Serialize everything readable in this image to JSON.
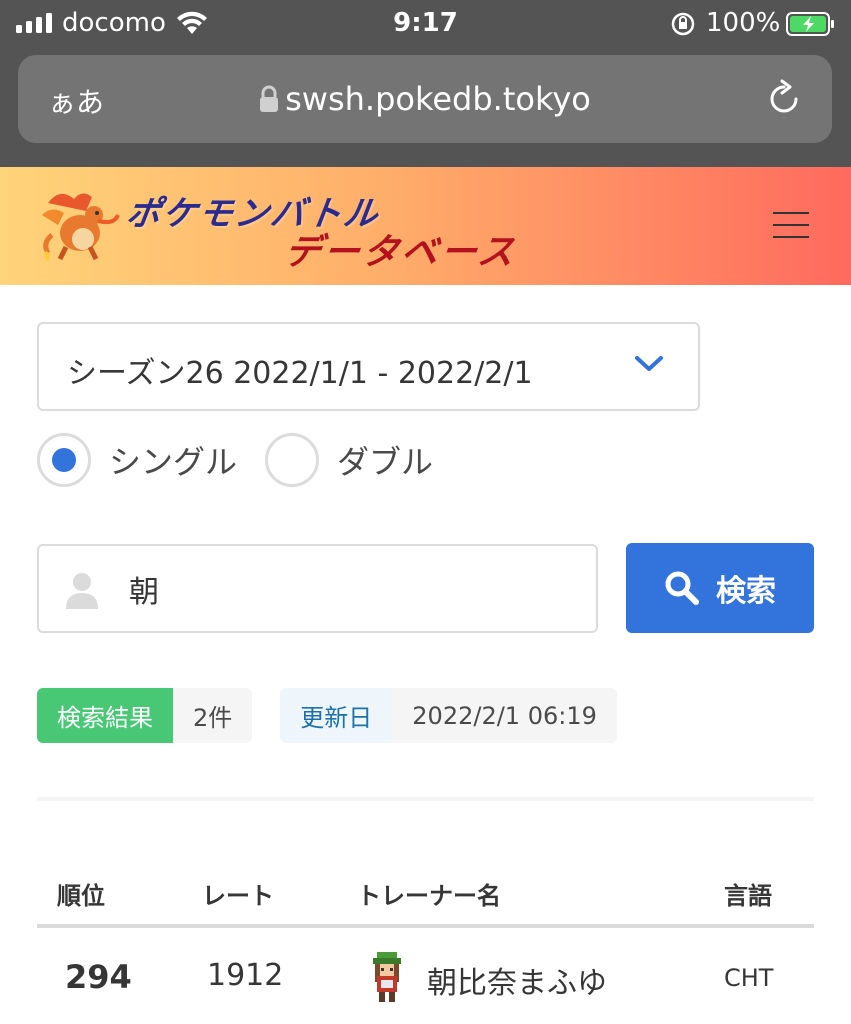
{
  "status_bar": {
    "carrier": "docomo",
    "time": "9:17",
    "battery_pct": "100%"
  },
  "browser": {
    "text_size_button": "ぁあ",
    "url": "swsh.pokedb.tokyo"
  },
  "header": {
    "logo_line1": "ポケモンバトル",
    "logo_line2": "データベース"
  },
  "filters": {
    "season_selected": "シーズン26  2022/1/1 - 2022/2/1",
    "format_options": [
      {
        "label": "シングル",
        "selected": true
      },
      {
        "label": "ダブル",
        "selected": false
      }
    ]
  },
  "search": {
    "query": "朝",
    "button_label": "検索"
  },
  "result_tags": {
    "results_label": "検索結果",
    "results_count": "2件",
    "updated_label": "更新日",
    "updated_value": "2022/2/1 06:19"
  },
  "table": {
    "headers": [
      "順位",
      "レート",
      "トレーナー名",
      "言語"
    ],
    "rows": [
      {
        "rank": "294",
        "rate": "1912",
        "trainer": "朝比奈まふゆ",
        "lang": "CHT"
      }
    ]
  },
  "colors": {
    "primary": "#3273dc",
    "success": "#48c774",
    "info_text": "#1d72aa"
  }
}
